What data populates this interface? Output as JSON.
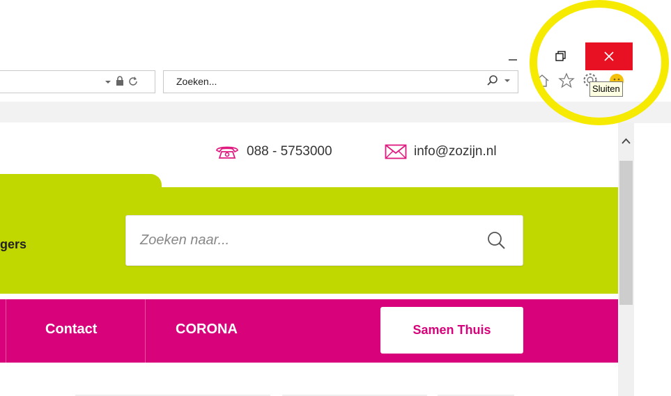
{
  "browser": {
    "search_box": {
      "placeholder": "Zoeken..."
    },
    "close_tooltip": "Sluiten",
    "colors": {
      "close_button": "#e81123",
      "highlight_ring": "#f5ea00"
    }
  },
  "site": {
    "phone": "088 - 5753000",
    "email": "info@zozijn.nl",
    "nav_partial": "gers",
    "search": {
      "placeholder": "Zoeken naar..."
    },
    "nav": [
      {
        "label": "Contact"
      },
      {
        "label": "CORONA"
      }
    ],
    "cta_label": "Samen Thuis",
    "colors": {
      "green": "#c1d800",
      "pink": "#d8027a"
    }
  }
}
